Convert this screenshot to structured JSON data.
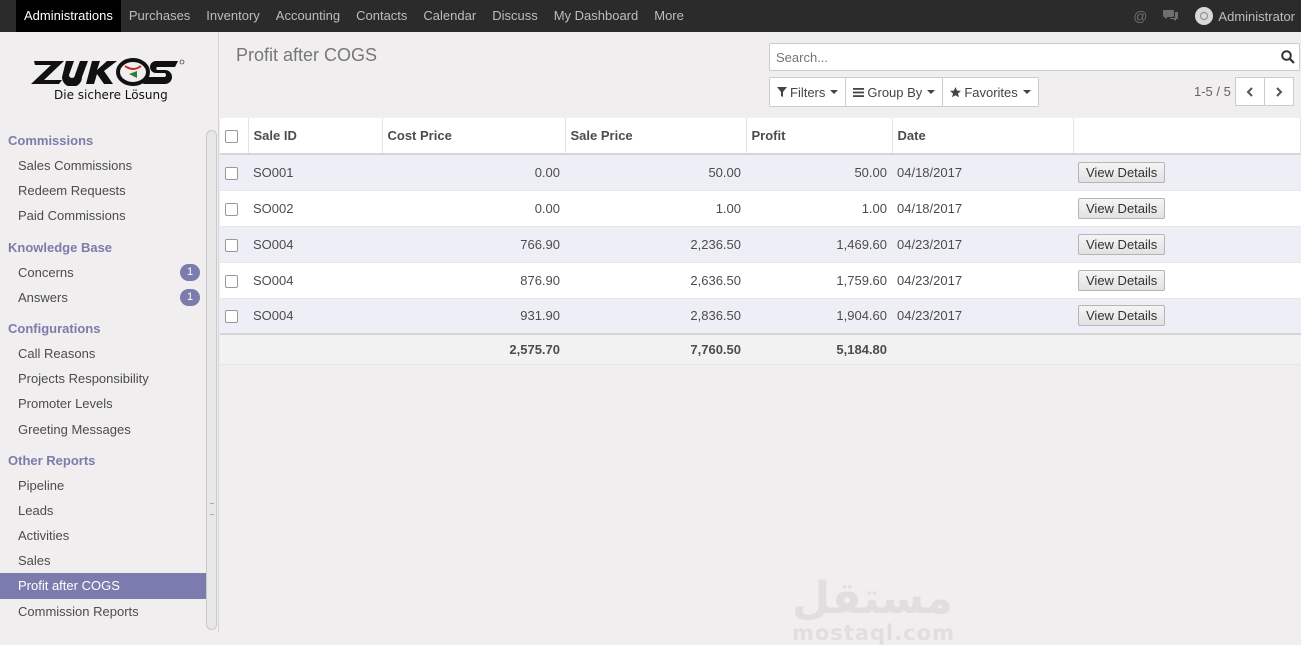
{
  "topnav": {
    "items": [
      "Administrations",
      "Purchases",
      "Inventory",
      "Accounting",
      "Contacts",
      "Calendar",
      "Discuss",
      "My Dashboard",
      "More"
    ],
    "active_index": 0,
    "user": "Administrator",
    "icons": [
      "at-icon",
      "chat-icon"
    ]
  },
  "logo": {
    "brand": "ZUKOS",
    "tagline": "Die sichere Lösung"
  },
  "sidebar": {
    "sections": [
      {
        "title": "Commissions",
        "items": [
          {
            "label": "Sales Commissions"
          },
          {
            "label": "Redeem Requests"
          },
          {
            "label": "Paid Commissions"
          }
        ]
      },
      {
        "title": "Knowledge Base",
        "items": [
          {
            "label": "Concerns",
            "badge": "1"
          },
          {
            "label": "Answers",
            "badge": "1"
          }
        ]
      },
      {
        "title": "Configurations",
        "items": [
          {
            "label": "Call Reasons"
          },
          {
            "label": "Projects Responsibility"
          },
          {
            "label": "Promoter Levels"
          },
          {
            "label": "Greeting Messages"
          }
        ]
      },
      {
        "title": "Other Reports",
        "items": [
          {
            "label": "Pipeline"
          },
          {
            "label": "Leads"
          },
          {
            "label": "Activities"
          },
          {
            "label": "Sales"
          },
          {
            "label": "Profit after COGS",
            "active": true
          },
          {
            "label": "Commission Reports"
          }
        ]
      }
    ]
  },
  "main": {
    "title": "Profit after COGS",
    "search_placeholder": "Search...",
    "filters_label": "Filters",
    "groupby_label": "Group By",
    "favorites_label": "Favorites",
    "pager": "1-5 / 5"
  },
  "table": {
    "columns": [
      "Sale ID",
      "Cost Price",
      "Sale Price",
      "Profit",
      "Date"
    ],
    "rows": [
      [
        "SO001",
        "0.00",
        "50.00",
        "50.00",
        "04/18/2017"
      ],
      [
        "SO002",
        "0.00",
        "1.00",
        "1.00",
        "04/18/2017"
      ],
      [
        "SO004",
        "766.90",
        "2,236.50",
        "1,469.60",
        "04/23/2017"
      ],
      [
        "SO004",
        "876.90",
        "2,636.50",
        "1,759.60",
        "04/23/2017"
      ],
      [
        "SO004",
        "931.90",
        "2,836.50",
        "1,904.60",
        "04/23/2017"
      ]
    ],
    "row_button": "View Details",
    "totals": [
      "2,575.70",
      "7,760.50",
      "5,184.80"
    ]
  },
  "watermark": {
    "arabic": "مستقل",
    "latin": "mostaql.com"
  },
  "colors": {
    "accent": "#7c7bad",
    "topbar": "#2b2b2b",
    "row_alt": "#eeeef6"
  }
}
